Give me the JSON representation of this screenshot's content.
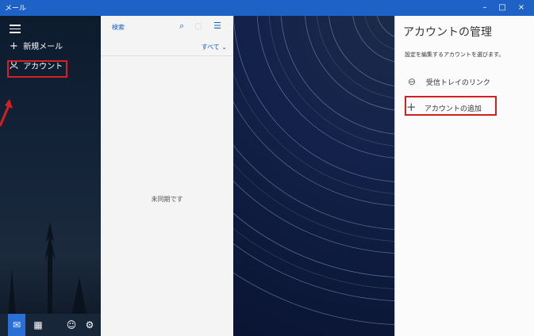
{
  "window": {
    "title": "メール",
    "min": "–",
    "max": "□",
    "close": "×"
  },
  "sidebar": {
    "new_mail": "新規メール",
    "account": "アカウント"
  },
  "list": {
    "search_placeholder": "検索",
    "filter": "すべて ⌄",
    "empty_message": "未同期です"
  },
  "panel": {
    "title": "アカウントの管理",
    "description": "設定を編集するアカウントを選びます。",
    "inbox_link": "受信トレイのリンク",
    "add_account": "アカウントの追加"
  },
  "colors": {
    "accent": "#1e62c8",
    "highlight": "#d32020"
  }
}
